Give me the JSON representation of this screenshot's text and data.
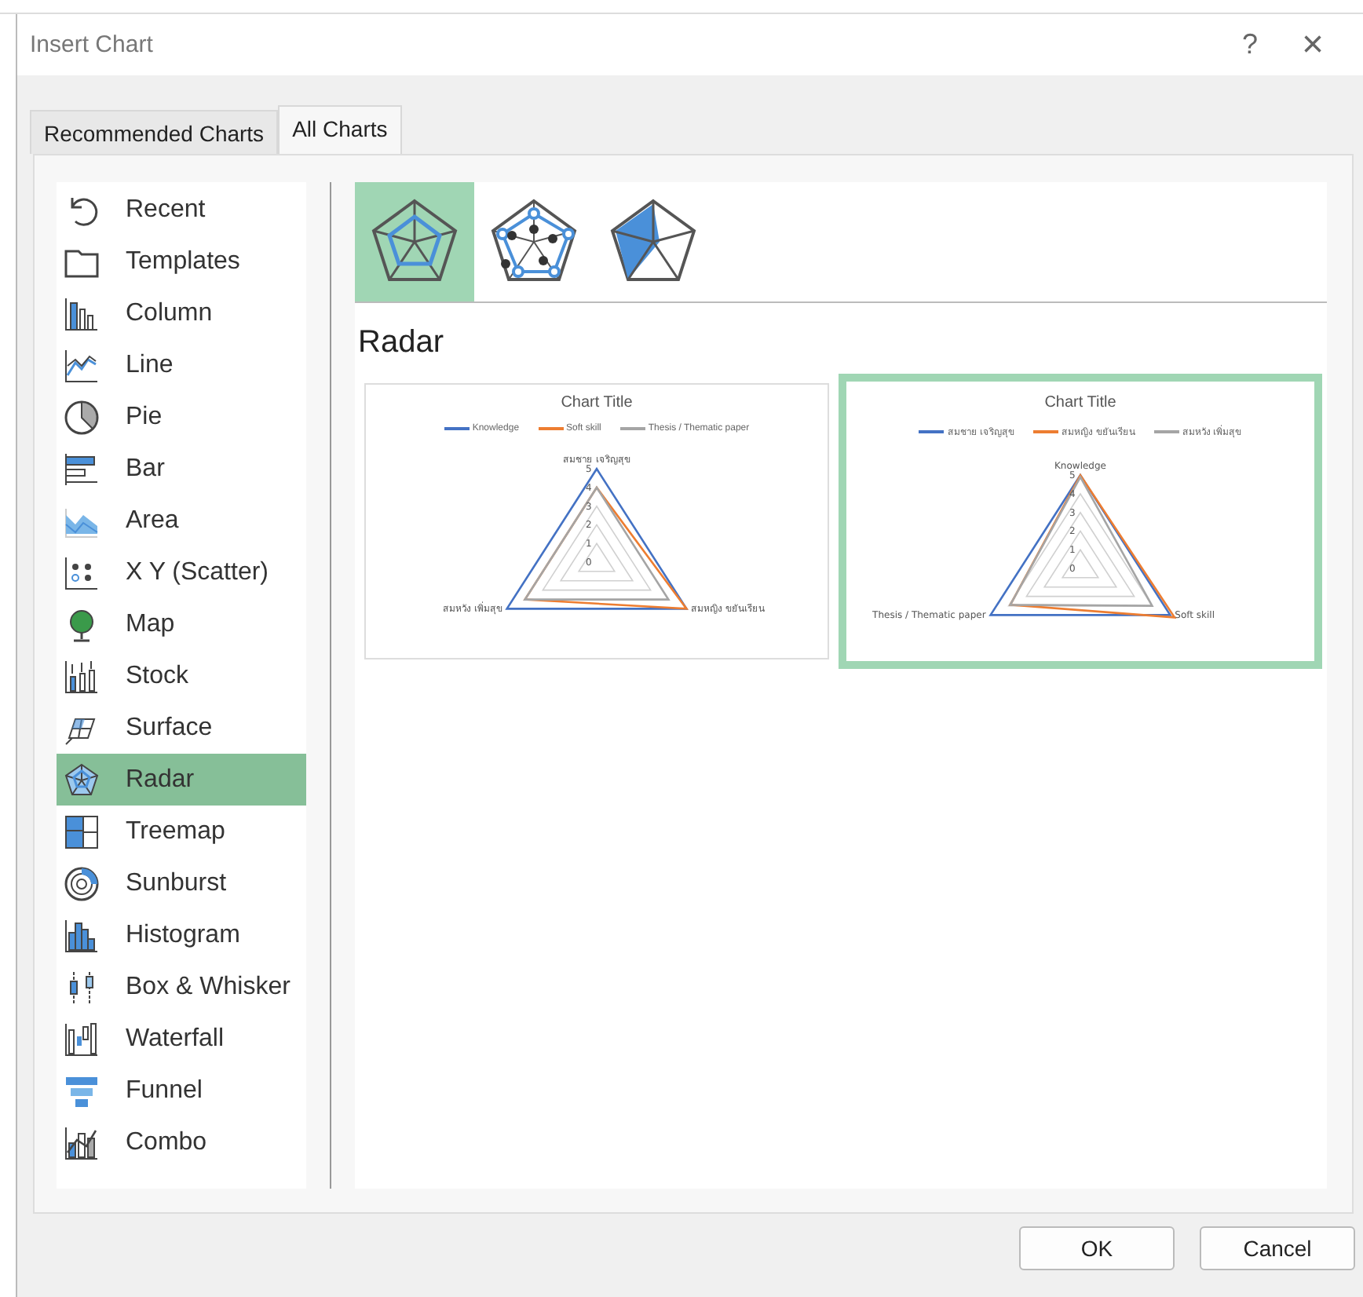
{
  "window": {
    "title": "Insert Chart",
    "help": "?",
    "close": "×"
  },
  "tabs": [
    {
      "label": "Recommended Charts",
      "selected": false
    },
    {
      "label": "All Charts",
      "selected": true
    }
  ],
  "sidebar": {
    "items": [
      {
        "label": "Recent",
        "selected": false
      },
      {
        "label": "Templates",
        "selected": false
      },
      {
        "label": "Column",
        "selected": false
      },
      {
        "label": "Line",
        "selected": false
      },
      {
        "label": "Pie",
        "selected": false
      },
      {
        "label": "Bar",
        "selected": false
      },
      {
        "label": "Area",
        "selected": false
      },
      {
        "label": "X Y (Scatter)",
        "selected": false
      },
      {
        "label": "Map",
        "selected": false
      },
      {
        "label": "Stock",
        "selected": false
      },
      {
        "label": "Surface",
        "selected": false
      },
      {
        "label": "Radar",
        "selected": true
      },
      {
        "label": "Treemap",
        "selected": false
      },
      {
        "label": "Sunburst",
        "selected": false
      },
      {
        "label": "Histogram",
        "selected": false
      },
      {
        "label": "Box & Whisker",
        "selected": false
      },
      {
        "label": "Waterfall",
        "selected": false
      },
      {
        "label": "Funnel",
        "selected": false
      },
      {
        "label": "Combo",
        "selected": false
      }
    ]
  },
  "subtypes": [
    {
      "selected": true
    },
    {
      "selected": false
    },
    {
      "selected": false
    }
  ],
  "heading": "Radar",
  "previews": [
    {
      "selected": false,
      "title": "Chart Title",
      "legend": [
        {
          "name": "Knowledge",
          "color": "#4472c4"
        },
        {
          "name": "Soft skill",
          "color": "#ed7d31"
        },
        {
          "name": "Thesis / Thematic paper",
          "color": "#a5a5a5"
        }
      ],
      "axes": [
        "สมชาย เจริญสุข",
        "สมหวัง เพิ่มสุข",
        "สมหญิง ขยันเรียน"
      ],
      "ticks": [
        "5",
        "4",
        "3",
        "2",
        "1",
        "0"
      ]
    },
    {
      "selected": true,
      "title": "Chart Title",
      "legend": [
        {
          "name": "สมชาย เจริญสุข",
          "color": "#4472c4"
        },
        {
          "name": "สมหญิง ขยันเรียน",
          "color": "#ed7d31"
        },
        {
          "name": "สมหวัง เพิ่มสุข",
          "color": "#a5a5a5"
        }
      ],
      "axes": [
        "Knowledge",
        "Thesis / Thematic paper",
        "Soft skill"
      ],
      "ticks": [
        "5",
        "4",
        "3",
        "2",
        "1",
        "0"
      ]
    }
  ],
  "buttons": [
    {
      "label": "OK"
    },
    {
      "label": "Cancel"
    }
  ]
}
